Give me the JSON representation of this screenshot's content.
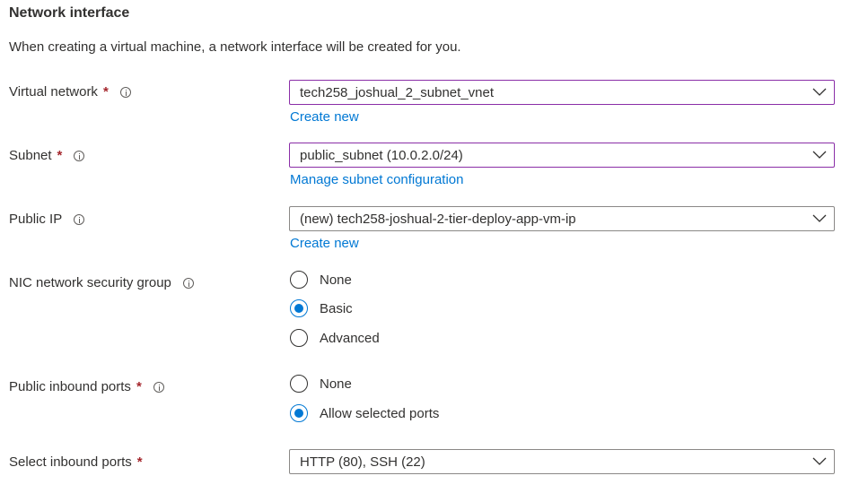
{
  "section": {
    "title": "Network interface",
    "description": "When creating a virtual machine, a network interface will be created for you."
  },
  "required_mark": "*",
  "fields": {
    "virtual_network": {
      "label": "Virtual network",
      "value": "tech258_joshual_2_subnet_vnet",
      "link": "Create new"
    },
    "subnet": {
      "label": "Subnet",
      "value": "public_subnet (10.0.2.0/24)",
      "link": "Manage subnet configuration"
    },
    "public_ip": {
      "label": "Public IP",
      "value": "(new) tech258-joshual-2-tier-deploy-app-vm-ip",
      "link": "Create new"
    },
    "nic_nsg": {
      "label": "NIC network security group",
      "options": [
        "None",
        "Basic",
        "Advanced"
      ],
      "selected": "Basic"
    },
    "public_inbound_ports": {
      "label": "Public inbound ports",
      "options": [
        "None",
        "Allow selected ports"
      ],
      "selected": "Allow selected ports"
    },
    "select_inbound_ports": {
      "label": "Select inbound ports",
      "value": "HTTP (80), SSH (22)"
    }
  },
  "icons": {
    "info": "info-circle-icon",
    "dropdown": "chevron-down-icon"
  },
  "colors": {
    "link": "#0078d4",
    "required": "#a4262c",
    "focus_border": "#8a2ea7",
    "radio_checked": "#0078d4"
  }
}
